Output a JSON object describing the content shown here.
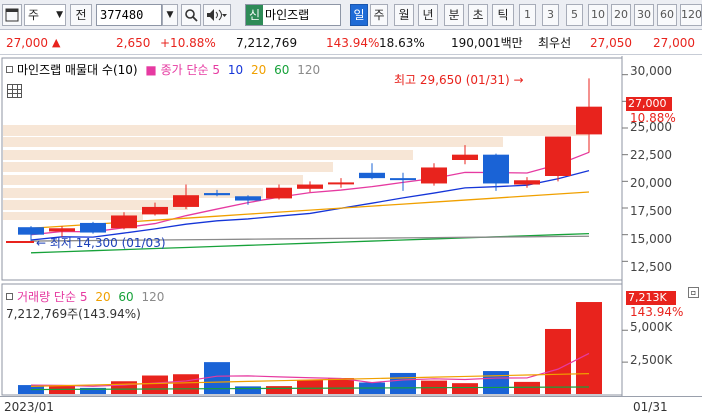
{
  "toolbar": {
    "window_icon": "window-icon",
    "market_label": "주",
    "jeon_label": "전",
    "stock_code": "377480",
    "sin_badge": "신",
    "stock_name": "마인즈랩",
    "periods": [
      "일",
      "주",
      "월",
      "년",
      "분",
      "초",
      "틱"
    ],
    "selected_period": "일",
    "intervals": [
      "1",
      "3",
      "5",
      "10",
      "20",
      "30",
      "60",
      "120"
    ]
  },
  "quote": {
    "price": "27,000",
    "change_arrow": "▲",
    "change": "2,650",
    "change_pct": "+10.88%",
    "volume": "7,212,769",
    "volume_ratio": "143.94%",
    "turnover": "18.63%",
    "amount": "190,001백만",
    "best_ask_label": "최우선",
    "best_ask": "27,050",
    "best_bid": "27,000"
  },
  "price_legend": {
    "title": "마인즈랩 매물대 수(10)",
    "close_label": "종가 단순",
    "ma": [
      "5",
      "10",
      "20",
      "60",
      "120"
    ]
  },
  "annotations": {
    "high": "최고 29,650 (01/31) →",
    "low": "← 최저 14,300 (01/03)"
  },
  "price_axis": {
    "ticks": [
      "30,000",
      "27,500",
      "25,000",
      "22,500",
      "20,000",
      "17,500",
      "15,000",
      "12,500"
    ],
    "current_tag": "27,000",
    "current_pct": "10.88%"
  },
  "volume_legend": {
    "title": "거래량 단순",
    "ma": [
      "5",
      "20",
      "60",
      "120"
    ],
    "summary": "7,212,769주(143.94%)"
  },
  "volume_axis": {
    "ticks": [
      "5,000K",
      "2,500K"
    ],
    "current_tag": "7,213K",
    "current_pct": "143.94%"
  },
  "x_axis": {
    "start": "2023/01",
    "end": "01/31"
  },
  "colors": {
    "up": "#e8231d",
    "down": "#1a63d6",
    "ma5": "#e63aa1",
    "ma10": "#1535d8",
    "ma20": "#f0a000",
    "ma60": "#17a23a",
    "ma120": "#8a8a8a"
  },
  "chart_data": [
    {
      "type": "candlestick",
      "title": "마인즈랩",
      "ylim": [
        11500,
        31000
      ],
      "candles": [
        {
          "o": 15700,
          "h": 15800,
          "l": 14300,
          "c": 15000
        },
        {
          "o": 15300,
          "h": 15800,
          "l": 14800,
          "c": 15600
        },
        {
          "o": 16100,
          "h": 16200,
          "l": 15100,
          "c": 15200
        },
        {
          "o": 15600,
          "h": 17100,
          "l": 15500,
          "c": 16800
        },
        {
          "o": 16900,
          "h": 18000,
          "l": 16800,
          "c": 17600
        },
        {
          "o": 17600,
          "h": 19700,
          "l": 17400,
          "c": 18700
        },
        {
          "o": 18900,
          "h": 19200,
          "l": 18600,
          "c": 18700
        },
        {
          "o": 18600,
          "h": 18700,
          "l": 17800,
          "c": 18200
        },
        {
          "o": 18400,
          "h": 19700,
          "l": 18300,
          "c": 19400
        },
        {
          "o": 19300,
          "h": 20000,
          "l": 19000,
          "c": 19700
        },
        {
          "o": 19800,
          "h": 20300,
          "l": 19400,
          "c": 19900
        },
        {
          "o": 20800,
          "h": 21700,
          "l": 20200,
          "c": 20300
        },
        {
          "o": 20300,
          "h": 20800,
          "l": 19100,
          "c": 20200
        },
        {
          "o": 19800,
          "h": 21700,
          "l": 19600,
          "c": 21300
        },
        {
          "o": 22000,
          "h": 23400,
          "l": 21600,
          "c": 22500
        },
        {
          "o": 22500,
          "h": 22600,
          "l": 19100,
          "c": 19800
        },
        {
          "o": 19700,
          "h": 20400,
          "l": 19400,
          "c": 20100
        },
        {
          "o": 20500,
          "h": 24200,
          "l": 20000,
          "c": 24200
        },
        {
          "o": 24400,
          "h": 29650,
          "l": 22700,
          "c": 27000
        }
      ],
      "volume": [
        700,
        650,
        480,
        1000,
        1450,
        1550,
        2500,
        600,
        620,
        1100,
        1250,
        900,
        1650,
        1050,
        850,
        1800,
        950,
        5100,
        7213
      ],
      "vol_ylim": [
        0,
        8000
      ]
    }
  ]
}
